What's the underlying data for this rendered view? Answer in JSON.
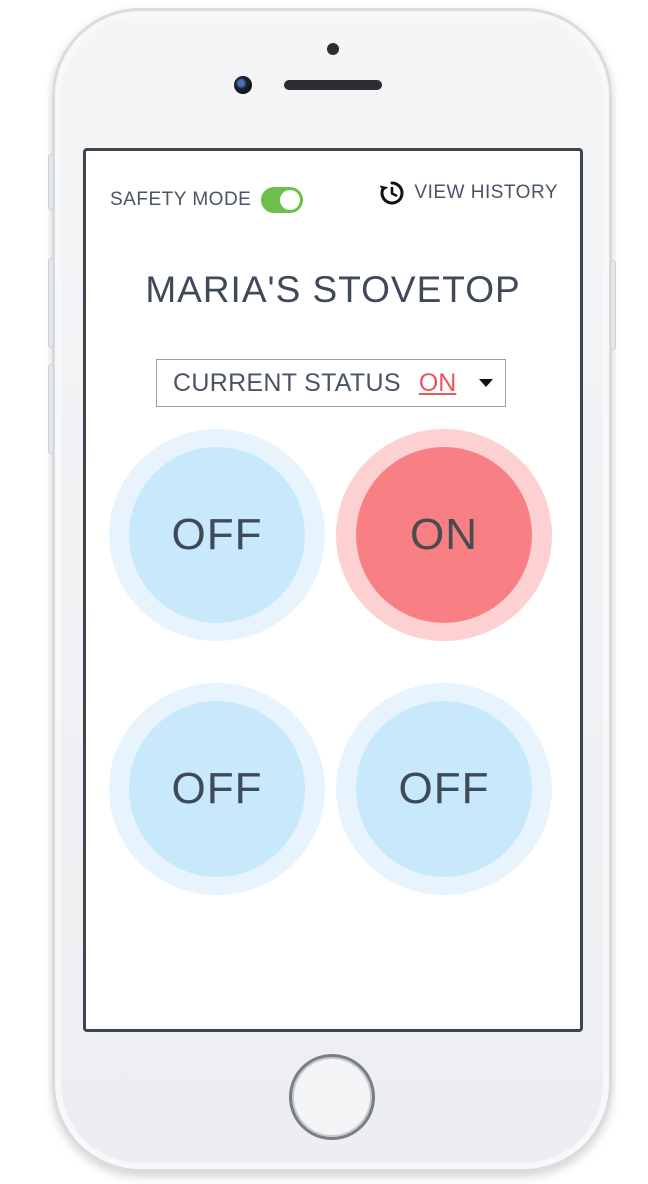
{
  "header": {
    "safety_mode_label": "SAFETY MODE",
    "safety_mode_enabled": true,
    "view_history_label": "VIEW HISTORY"
  },
  "title": "MARIA'S STOVETOP",
  "status": {
    "label": "CURRENT STATUS",
    "value": "ON"
  },
  "burners": [
    {
      "label": "OFF",
      "state": "off"
    },
    {
      "label": "ON",
      "state": "on"
    },
    {
      "label": "OFF",
      "state": "off"
    },
    {
      "label": "OFF",
      "state": "off"
    }
  ],
  "colors": {
    "toggle_on": "#6cc04a",
    "status_on": "#e8575c",
    "burner_off_ring": "#e7f4fd",
    "burner_off_fill": "#c8e8fb",
    "burner_on_ring": "#fdd0d2",
    "burner_on_fill": "#f87f83",
    "text": "#4a5563"
  },
  "icons": {
    "history": "history-clock-icon",
    "caret": "caret-down-icon"
  }
}
